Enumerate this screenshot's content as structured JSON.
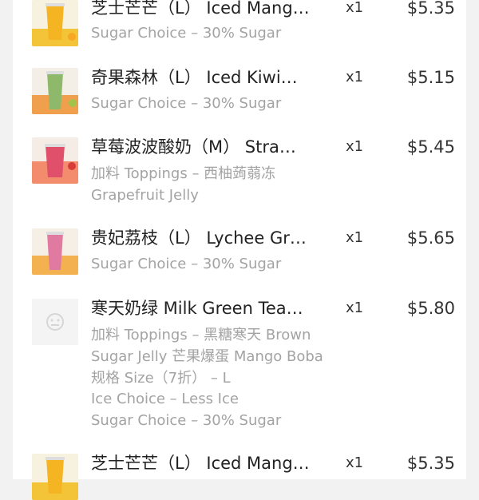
{
  "order": {
    "items": [
      {
        "name": "芝士芒芒（L） Iced Mang…",
        "qty": "x1",
        "price": "$5.35",
        "icon": "mango-drink-icon",
        "options": [
          "Sugar Choice –  30% Sugar"
        ]
      },
      {
        "name": "奇果森林（L） Iced Kiwi…",
        "qty": "x1",
        "price": "$5.15",
        "icon": "kiwi-drink-icon",
        "options": [
          "Sugar Choice –  30% Sugar"
        ]
      },
      {
        "name": "草莓波波酸奶（M） Stra…",
        "qty": "x1",
        "price": "$5.45",
        "icon": "strawberry-drink-icon",
        "options": [
          "加料 Toppings –  西柚蒟蒻冻",
          "Grapefruit Jelly"
        ]
      },
      {
        "name": "贵妃荔枝（L） Lychee Gr…",
        "qty": "x1",
        "price": "$5.65",
        "icon": "lychee-drink-icon",
        "options": [
          "Sugar Choice –  30% Sugar"
        ]
      },
      {
        "name": "寒天奶绿 Milk Green Tea…",
        "qty": "x1",
        "price": "$5.80",
        "icon": "placeholder-image-icon",
        "options": [
          "加料 Toppings –  黑糖寒天 Brown",
          "Sugar Jelly 芒果爆蛋 Mango Boba",
          "规格 Size（7折） –  L",
          "Ice Choice –  Less Ice",
          "Sugar Choice –  30% Sugar"
        ]
      },
      {
        "name": "芝士芒芒（L） Iced Mang…",
        "qty": "x1",
        "price": "$5.35",
        "icon": "mango-drink-icon",
        "options": []
      }
    ]
  }
}
